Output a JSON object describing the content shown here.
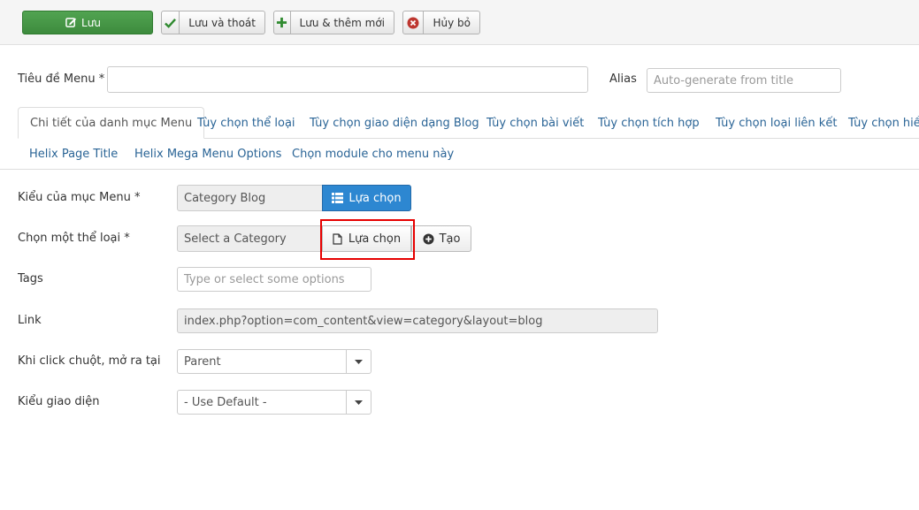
{
  "toolbar": {
    "save": "Lưu",
    "save_close": "Lưu và thoát",
    "save_new": "Lưu & thêm mới",
    "cancel": "Hủy bỏ"
  },
  "title_row": {
    "label": "Tiêu đề Menu *",
    "value": "",
    "alias_label": "Alias",
    "alias_placeholder": "Auto-generate from title"
  },
  "tabs_row1": [
    "Chi tiết của danh mục Menu",
    "Tùy chọn thể loại",
    "Tùy chọn giao diện dạng Blog",
    "Tùy chọn bài viết",
    "Tùy chọn tích hợp",
    "Tùy chọn loại liên kết",
    "Tùy chọn hiển"
  ],
  "tabs_row2": [
    "Helix Page Title",
    "Helix Mega Menu Options",
    "Chọn module cho menu này"
  ],
  "form": {
    "menu_type": {
      "label": "Kiểu của mục Menu *",
      "value": "Category Blog",
      "button": "Lựa chọn"
    },
    "category": {
      "label": "Chọn một thể loại *",
      "value": "Select a Category",
      "select_button": "Lựa chọn",
      "create_button": "Tạo"
    },
    "tags": {
      "label": "Tags",
      "placeholder": "Type or select some options"
    },
    "link": {
      "label": "Link",
      "value": "index.php?option=com_content&view=category&layout=blog"
    },
    "target": {
      "label": "Khi click chuột, mở ra tại",
      "value": "Parent"
    },
    "template": {
      "label": "Kiểu giao diện",
      "value": "- Use Default -"
    }
  },
  "colors": {
    "primary_green": "#4cae4c",
    "primary_blue": "#2d87d1",
    "link_blue": "#2a6496",
    "highlight_red": "#e60000"
  }
}
